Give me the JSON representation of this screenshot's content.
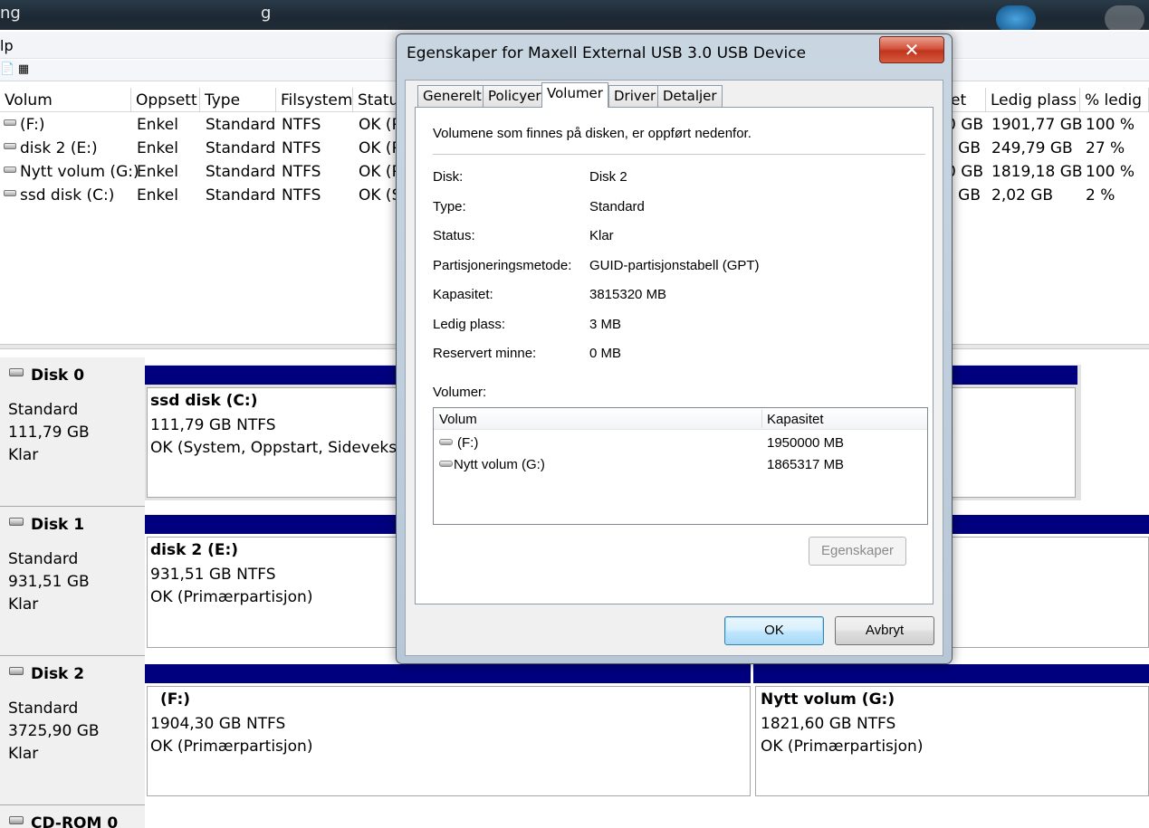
{
  "taskbar": {
    "label_left": "ng",
    "label_mid": "g"
  },
  "menu": {
    "help_label": "lp"
  },
  "toolbar": {
    "icons": [
      "properties-icon",
      "help-icon"
    ]
  },
  "volume_list": {
    "columns": [
      "Volum",
      "Oppsett",
      "Type",
      "Filsystem",
      "Status",
      "et",
      "Ledig plass",
      "% ledig"
    ],
    "rows": [
      {
        "volum": "(F:)",
        "oppsett": "Enkel",
        "type": "Standard",
        "filsystem": "NTFS",
        "status": "OK (P",
        "capacity_tail": "0 GB",
        "ledig": "1901,77 GB",
        "pct": "100 %"
      },
      {
        "volum": "disk 2 (E:)",
        "oppsett": "Enkel",
        "type": "Standard",
        "filsystem": "NTFS",
        "status": "OK (P",
        "capacity_tail": "GB",
        "ledig": "249,79 GB",
        "pct": "27 %"
      },
      {
        "volum": "Nytt volum (G:)",
        "oppsett": "Enkel",
        "type": "Standard",
        "filsystem": "NTFS",
        "status": "OK (P",
        "capacity_tail": "0 GB",
        "ledig": "1819,18 GB",
        "pct": "100 %"
      },
      {
        "volum": "ssd disk (C:)",
        "oppsett": "Enkel",
        "type": "Standard",
        "filsystem": "NTFS",
        "status": "OK (S",
        "capacity_tail": "GB",
        "ledig": "2,02 GB",
        "pct": "2 %"
      }
    ]
  },
  "disks": [
    {
      "name": "Disk 0",
      "type": "Standard",
      "size": "111,79 GB",
      "state": "Klar",
      "partitions": [
        {
          "name": "ssd disk  (C:)",
          "size": "111,79 GB NTFS",
          "status": "OK (System, Oppstart, Sideveksling"
        }
      ]
    },
    {
      "name": "Disk 1",
      "type": "Standard",
      "size": "931,51 GB",
      "state": "Klar",
      "partitions": [
        {
          "name": "disk 2  (E:)",
          "size": "931,51 GB NTFS",
          "status": "OK (Primærpartisjon)"
        }
      ]
    },
    {
      "name": "Disk 2",
      "type": "Standard",
      "size": "3725,90 GB",
      "state": "Klar",
      "partitions": [
        {
          "name": "(F:)",
          "size": "1904,30 GB NTFS",
          "status": "OK (Primærpartisjon)"
        },
        {
          "name": "Nytt volum  (G:)",
          "size": "1821,60 GB NTFS",
          "status": "OK (Primærpartisjon)"
        }
      ]
    },
    {
      "name": "CD-ROM 0"
    }
  ],
  "dialog": {
    "title": "Egenskaper for Maxell External USB 3.0 USB Device",
    "close_label": "✕",
    "tabs": [
      "Generelt",
      "Policyer",
      "Volumer",
      "Driver",
      "Detaljer"
    ],
    "active_tab": "Volumer",
    "intro": "Volumene som finnes på disken, er oppført nedenfor.",
    "props": [
      {
        "label": "Disk:",
        "value": "Disk 2"
      },
      {
        "label": "Type:",
        "value": "Standard"
      },
      {
        "label": "Status:",
        "value": "Klar"
      },
      {
        "label": "Partisjoneringsmetode:",
        "value": "GUID-partisjonstabell (GPT)"
      },
      {
        "label": "Kapasitet:",
        "value": "3815320 MB"
      },
      {
        "label": "Ledig plass:",
        "value": "3 MB"
      },
      {
        "label": "Reservert minne:",
        "value": "0 MB"
      }
    ],
    "volumes_label": "Volumer:",
    "volumes_columns": [
      "Volum",
      "Kapasitet"
    ],
    "volumes": [
      {
        "name": "(F:)",
        "capacity": "1950000 MB"
      },
      {
        "name": "Nytt volum (G:)",
        "capacity": "1865317 MB"
      }
    ],
    "properties_button": "Egenskaper",
    "ok_button": "OK",
    "cancel_button": "Avbryt"
  }
}
